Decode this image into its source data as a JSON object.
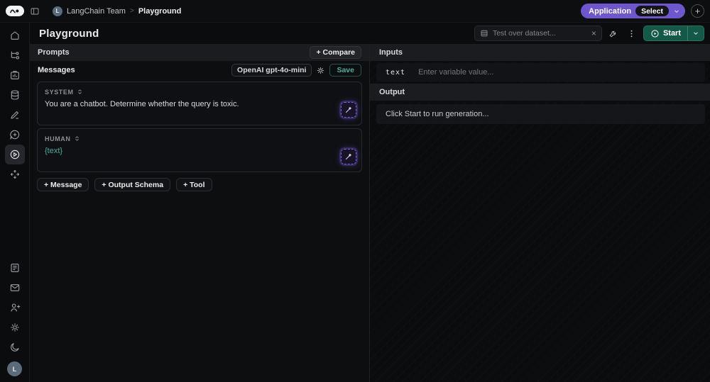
{
  "topbar": {
    "team_name": "LangChain Team",
    "breadcrumb_separator": ">",
    "page_name": "Playground",
    "team_initial": "L",
    "application_label": "Application",
    "select_label": "Select",
    "new_label": "+"
  },
  "header": {
    "title": "Playground",
    "dataset_placeholder": "Test over dataset...",
    "clear_glyph": "×",
    "start_label": "Start"
  },
  "prompts": {
    "panel_title": "Prompts",
    "compare_label": "+ Compare",
    "messages_title": "Messages",
    "model_badge": "OpenAI gpt-4o-mini",
    "save_label": "Save",
    "messages": [
      {
        "role": "SYSTEM",
        "content": "You are a chatbot. Determine whether the query is toxic."
      },
      {
        "role": "HUMAN",
        "content": "{text}"
      }
    ],
    "add_message_label": "+ Message",
    "add_output_schema_label": "+ Output Schema",
    "add_tool_label": "+ Tool"
  },
  "inputs": {
    "panel_title": "Inputs",
    "variable_name": "text",
    "value_placeholder": "Enter variable value..."
  },
  "output": {
    "panel_title": "Output",
    "empty_text": "Click Start to run generation..."
  },
  "user": {
    "avatar_initial": "L"
  },
  "colors": {
    "accent_purple": "#6e56cf",
    "accent_green": "#145847",
    "accent_teal_text": "#4fae9b"
  }
}
